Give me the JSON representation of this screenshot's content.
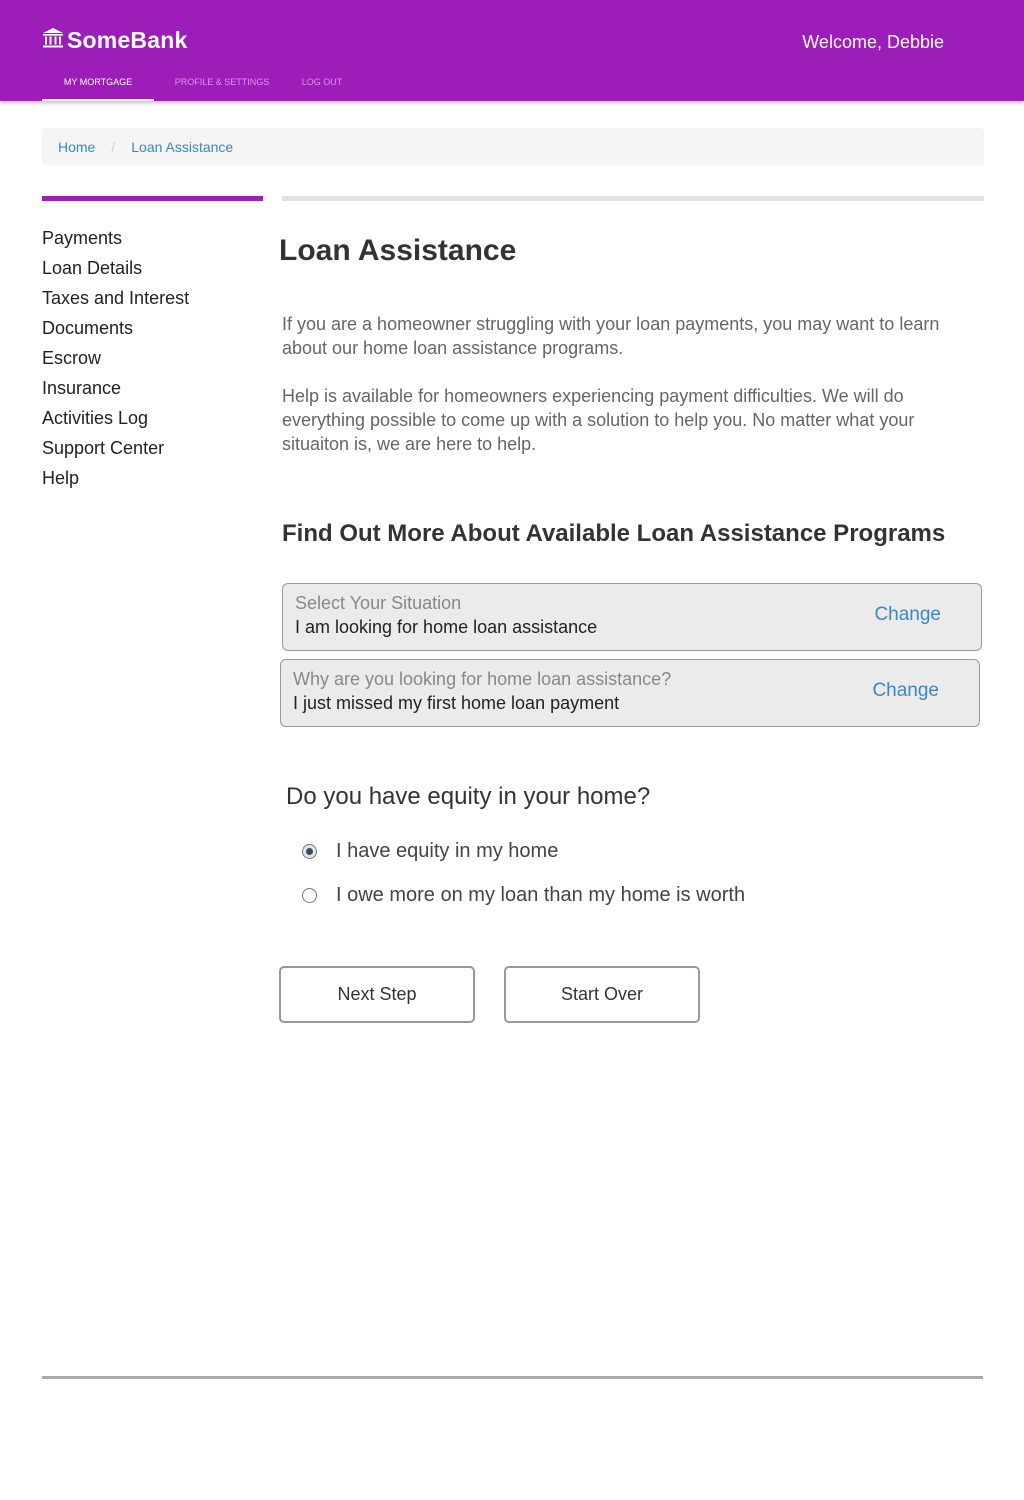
{
  "header": {
    "brand": "SomeBank",
    "welcome": "Welcome, Debbie",
    "nav": [
      {
        "label": "MY MORTGAGE",
        "active": true
      },
      {
        "label": "PROFILE & SETTINGS",
        "active": false
      },
      {
        "label": "LOG OUT",
        "active": false
      }
    ]
  },
  "breadcrumb": {
    "items": [
      "Home",
      "Loan Assistance"
    ],
    "separator": "/"
  },
  "sidebar": {
    "items": [
      {
        "label": "Payments"
      },
      {
        "label": "Loan Details"
      },
      {
        "label": "Taxes and Interest"
      },
      {
        "label": "Documents"
      },
      {
        "label": "Escrow"
      },
      {
        "label": "Insurance"
      },
      {
        "label": "Activities Log"
      },
      {
        "label": "Support Center"
      },
      {
        "label": "Help"
      }
    ]
  },
  "main": {
    "title": "Loan Assistance",
    "paragraphs": [
      "If you are a homeowner struggling with your loan payments, you may want to learn about our home loan assistance programs.",
      "Help is available for homeowners experiencing payment difficulties. We will do everything possible to come up with a solution to help you. No matter what your situaiton is, we are here to help."
    ],
    "section_heading": "Find Out More About Available Loan Assistance Programs",
    "choices": [
      {
        "label": "Select Your Situation",
        "value": "I am looking for home loan assistance",
        "action": "Change"
      },
      {
        "label": "Why are you looking for home loan assistance?",
        "value": "I just missed my first home loan payment",
        "action": "Change"
      }
    ],
    "question": "Do you have equity in your home?",
    "options": [
      {
        "label": "I have equity in my home",
        "selected": true
      },
      {
        "label": "I owe more on my loan than my home is worth",
        "selected": false
      }
    ],
    "buttons": {
      "next": "Next Step",
      "start_over": "Start Over"
    }
  },
  "colors": {
    "brand": "#9c1db8",
    "link": "#3a87c8"
  },
  "icons": {
    "brand": "bank-icon"
  }
}
